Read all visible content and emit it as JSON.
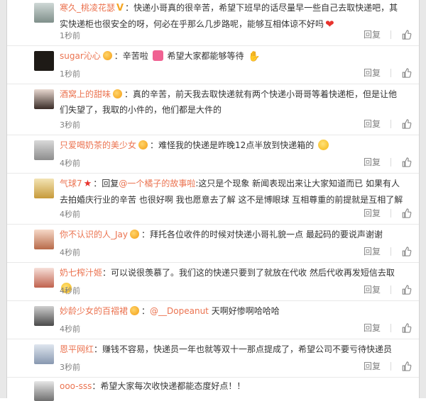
{
  "reply_label": "回复",
  "comments": [
    {
      "username": "寒久_桃凌花瑟",
      "text": "：快递小哥真的很辛苦，希望下班早的话尽量早一些自己去取快递吧，其实快递柜也很安全的呀，何必在乎那么几步路呢，能够互相体谅不好吗",
      "time": "1秒前",
      "avatar_icon": "avatar-icon"
    },
    {
      "username": "sugar沁心",
      "text": "：辛苦啦",
      "text2": "希望大家都能够等待",
      "time": "1秒前",
      "avatar_icon": "avatar-icon"
    },
    {
      "username": "酒窝上的甜味",
      "text": "：真的辛苦，前天我去取快递就有两个快递小哥哥等着快递柜，但是让他们失望了，我取的小件的，他们都是大件的",
      "time": "3秒前",
      "avatar_icon": "avatar-icon"
    },
    {
      "username": "只爱喝奶茶的美少女",
      "text": "：难怪我的快递是昨晚12点半放到快递箱的",
      "time": "4秒前",
      "avatar_icon": "avatar-icon"
    },
    {
      "username": "气球7",
      "reply_prefix": "：回复",
      "mention": "@一个橘子的故事啦",
      "text": ":这只是个现象 新闻表现出来让大家知道而已 如果有人去拍婚庆行业的辛苦 也很好啊 我也愿意去了解 这不是博眼球 互相尊重的前提就是互相了解",
      "time": "4秒前",
      "avatar_icon": "avatar-icon"
    },
    {
      "username": "你不认识的人_Jay",
      "text": "：拜托各位收件的时候对快递小哥礼貌一点 最起码的要说声谢谢",
      "time": "4秒前",
      "avatar_icon": "avatar-icon"
    },
    {
      "username": "奶七榨汁姬",
      "text": "：可以说很羡慕了。我们这的快递只要到了就放在代收 然后代收再发短信去取",
      "time": "4秒前",
      "avatar_icon": "avatar-icon"
    },
    {
      "username": "妙龄少女的百褶裙",
      "text_prefix": "：",
      "mention": "@__Dopeanut",
      "text": "天啊好惨啊哈哈哈",
      "time": "4秒前",
      "avatar_icon": "avatar-icon"
    },
    {
      "username": "恩平网红",
      "text": "：赚钱不容易，快递员一年也就等双十一那点提成了，希望公司不要亏待快递员",
      "time": "3秒前",
      "avatar_icon": "avatar-icon"
    },
    {
      "username": "ooo-sss",
      "text": "：希望大家每次收快递都能态度好点！！",
      "time": "",
      "avatar_icon": "avatar-icon"
    }
  ],
  "colors": {
    "username": "#eb7350",
    "text": "#333333",
    "meta": "#808080"
  }
}
